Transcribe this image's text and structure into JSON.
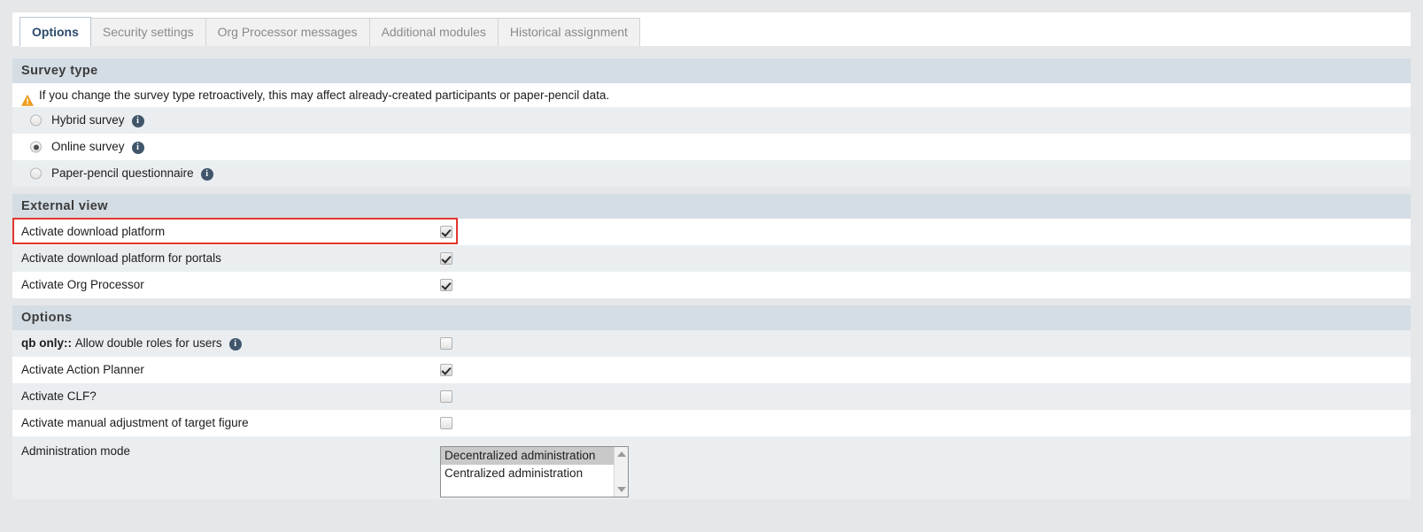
{
  "tabs": [
    {
      "label": "Options",
      "active": true
    },
    {
      "label": "Security settings",
      "active": false
    },
    {
      "label": "Org Processor messages",
      "active": false
    },
    {
      "label": "Additional modules",
      "active": false
    },
    {
      "label": "Historical assignment",
      "active": false
    }
  ],
  "sections": {
    "survey_type": {
      "title": "Survey type",
      "warning": "If you change the survey type retroactively, this may affect already-created participants or paper-pencil data.",
      "warning_icon": "warning-triangle-icon",
      "options": [
        {
          "label": "Hybrid survey",
          "selected": false,
          "info": "info-icon"
        },
        {
          "label": "Online survey",
          "selected": true,
          "info": "info-icon"
        },
        {
          "label": "Paper-pencil questionnaire",
          "selected": false,
          "info": "info-icon"
        }
      ]
    },
    "external_view": {
      "title": "External view",
      "rows": [
        {
          "label": "Activate download platform",
          "checked": true,
          "highlighted": true
        },
        {
          "label": "Activate download platform for portals",
          "checked": true,
          "highlighted": false
        },
        {
          "label": "Activate Org Processor",
          "checked": true,
          "highlighted": false
        }
      ]
    },
    "options": {
      "title": "Options",
      "rows": [
        {
          "label_bold": "qb only::",
          "label": "Allow double roles for users",
          "checked": false,
          "info": "info-icon"
        },
        {
          "label_bold": "",
          "label": "Activate Action Planner",
          "checked": true,
          "info": ""
        },
        {
          "label_bold": "",
          "label": "Activate CLF?",
          "checked": false,
          "info": ""
        },
        {
          "label_bold": "",
          "label": "Activate manual adjustment of target figure",
          "checked": false,
          "info": ""
        }
      ],
      "admin_mode": {
        "label": "Administration mode",
        "options": [
          {
            "label": "Decentralized administration",
            "selected": true
          },
          {
            "label": "Centralized administration",
            "selected": false
          }
        ]
      }
    }
  },
  "colors": {
    "section_header_bg": "#d4dde4",
    "row_alt_bg": "#eaeef1",
    "highlight_border": "#e2362f",
    "active_tab_text": "#2c4a6b",
    "warning_icon": "#f0a01e",
    "info_icon": "#41566a"
  }
}
